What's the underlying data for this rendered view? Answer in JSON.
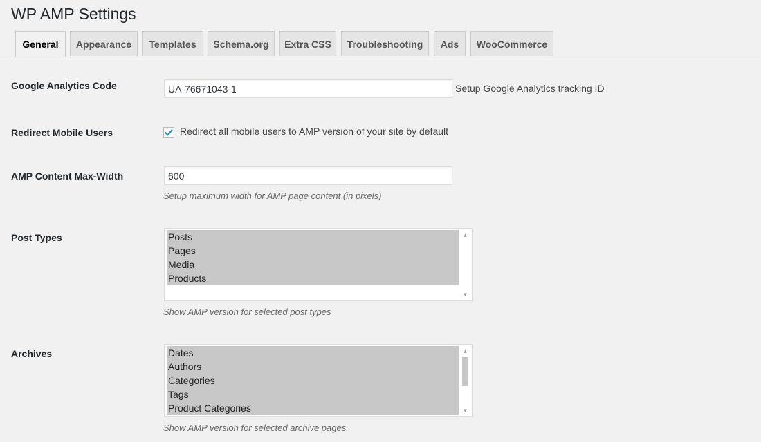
{
  "page": {
    "title": "WP AMP Settings"
  },
  "tabs": [
    {
      "label": "General",
      "active": true
    },
    {
      "label": "Appearance",
      "active": false
    },
    {
      "label": "Templates",
      "active": false
    },
    {
      "label": "Schema.org",
      "active": false
    },
    {
      "label": "Extra CSS",
      "active": false
    },
    {
      "label": "Troubleshooting",
      "active": false
    },
    {
      "label": "Ads",
      "active": false
    },
    {
      "label": "WooCommerce",
      "active": false
    }
  ],
  "settings": {
    "analytics": {
      "label": "Google Analytics Code",
      "value": "UA-76671043-1",
      "description": "Setup Google Analytics tracking ID"
    },
    "redirect": {
      "label": "Redirect Mobile Users",
      "checked": true,
      "checkbox_label": "Redirect all mobile users to AMP version of your site by default"
    },
    "max_width": {
      "label": "AMP Content Max-Width",
      "value": "600",
      "description": "Setup maximum width for AMP page content (in pixels)"
    },
    "post_types": {
      "label": "Post Types",
      "options": [
        "Posts",
        "Pages",
        "Media",
        "Products"
      ],
      "description": "Show AMP version for selected post types"
    },
    "archives": {
      "label": "Archives",
      "options": [
        "Dates",
        "Authors",
        "Categories",
        "Tags",
        "Product Categories"
      ],
      "description": "Show AMP version for selected archive pages."
    }
  },
  "icons": {
    "checkmark": "checkmark-icon",
    "scroll_up": "arrow-up-icon",
    "scroll_down": "arrow-down-icon"
  },
  "colors": {
    "background": "#f1f1f1",
    "checkmark": "#1e8cbe",
    "selected_option": "#c8c8c8"
  }
}
